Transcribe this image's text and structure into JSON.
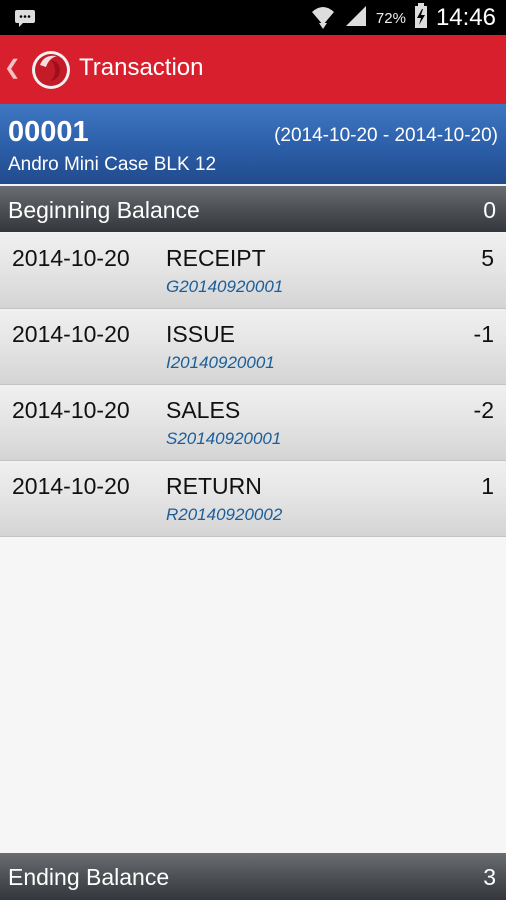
{
  "status_bar": {
    "battery": "72%",
    "time": "14:46"
  },
  "action_bar": {
    "title": "Transaction"
  },
  "item": {
    "code": "00001",
    "date_range": "(2014-10-20 - 2014-10-20)",
    "name": "Andro Mini Case BLK 12"
  },
  "beginning_balance": {
    "label": "Beginning Balance",
    "value": "0"
  },
  "transactions": [
    {
      "date": "2014-10-20",
      "type": "RECEIPT",
      "ref": "G20140920001",
      "qty": "5"
    },
    {
      "date": "2014-10-20",
      "type": "ISSUE",
      "ref": "I20140920001",
      "qty": "-1"
    },
    {
      "date": "2014-10-20",
      "type": "SALES",
      "ref": "S20140920001",
      "qty": "-2"
    },
    {
      "date": "2014-10-20",
      "type": "RETURN",
      "ref": "R20140920002",
      "qty": "1"
    }
  ],
  "ending_balance": {
    "label": "Ending Balance",
    "value": "3"
  },
  "colors": {
    "action_bar": "#d81f2e",
    "header": "#2c5ea8",
    "ref_text": "#1c5e9a"
  },
  "icons": [
    "bbm-icon",
    "wifi-icon",
    "signal-icon",
    "battery-charging-icon",
    "back-icon",
    "app-logo-icon"
  ]
}
